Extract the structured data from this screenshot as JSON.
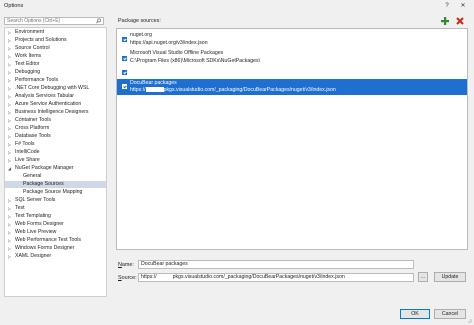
{
  "window": {
    "title": "Options",
    "help_label": "?",
    "close_label": "✕"
  },
  "search": {
    "placeholder": "Search Options (Ctrl+E)"
  },
  "tree": {
    "items": [
      {
        "label": "Environment",
        "arrow": "▷"
      },
      {
        "label": "Projects and Solutions",
        "arrow": "▷"
      },
      {
        "label": "Source Control",
        "arrow": "▷"
      },
      {
        "label": "Work Items",
        "arrow": "▷"
      },
      {
        "label": "Text Editor",
        "arrow": "▷"
      },
      {
        "label": "Debugging",
        "arrow": "▷"
      },
      {
        "label": "Performance Tools",
        "arrow": "▷"
      },
      {
        "label": ".NET Core Debugging with WSL",
        "arrow": "▷"
      },
      {
        "label": "Analysis Services Tabular",
        "arrow": "▷"
      },
      {
        "label": "Azure Service Authentication",
        "arrow": "▷"
      },
      {
        "label": "Business Intelligence Designers",
        "arrow": "▷"
      },
      {
        "label": "Container Tools",
        "arrow": "▷"
      },
      {
        "label": "Cross Platform",
        "arrow": "▷"
      },
      {
        "label": "Database Tools",
        "arrow": "▷"
      },
      {
        "label": "F# Tools",
        "arrow": "▷"
      },
      {
        "label": "IntelliCode",
        "arrow": "▷"
      },
      {
        "label": "Live Share",
        "arrow": "▷"
      },
      {
        "label": "NuGet Package Manager",
        "arrow": "◢"
      },
      {
        "label": "General",
        "arrow": "",
        "child": true
      },
      {
        "label": "Package Sources",
        "arrow": "",
        "child": true,
        "selected": true
      },
      {
        "label": "Package Source Mapping",
        "arrow": "",
        "child": true
      },
      {
        "label": "SQL Server Tools",
        "arrow": "▷"
      },
      {
        "label": "Test",
        "arrow": "▷"
      },
      {
        "label": "Text Templating",
        "arrow": "▷"
      },
      {
        "label": "Web Forms Designer",
        "arrow": "▷"
      },
      {
        "label": "Web Live Preview",
        "arrow": "▷"
      },
      {
        "label": "Web Performance Test Tools",
        "arrow": "▷"
      },
      {
        "label": "Windows Forms Designer",
        "arrow": "▷"
      },
      {
        "label": "XAML Designer",
        "arrow": "▷"
      }
    ]
  },
  "sources_panel": {
    "title": "Package sources:",
    "add_icon": "add-icon",
    "remove_icon": "remove-icon",
    "sources": [
      {
        "name": "nuget.org",
        "url": "https://api.nuget.org/v3/index.json",
        "checked": true
      },
      {
        "name": "Microsoft Visual Studio Offline Packages",
        "url": "C:\\Program Files (x86)\\Microsoft SDKs\\NuGetPackages\\",
        "checked": true
      },
      {
        "name": "",
        "url": "",
        "checked": true
      },
      {
        "name": "DocuBear packages",
        "url_prefix": "https://",
        "url": "pkgs.visualstudio.com/_packaging/DocuBearPackages/nuget/v3/index.json",
        "checked": true,
        "selected": true
      }
    ]
  },
  "form": {
    "name_label_u": "N",
    "name_label_rest": "ame:",
    "name_value": "DocuBear packages",
    "source_label_u": "S",
    "source_label_rest": "ource:",
    "source_prefix": "https://",
    "source_value": "pkgs.visualstudio.com/_packaging/DocuBearPackages/nuget/v3/index.json",
    "browse_label": "...",
    "update_label": "Update"
  },
  "footer": {
    "ok_label": "OK",
    "cancel_label": "Cancel"
  },
  "colors": {
    "accent": "#1f6fd0",
    "add": "#2e8b2e",
    "remove": "#c42b1c"
  }
}
